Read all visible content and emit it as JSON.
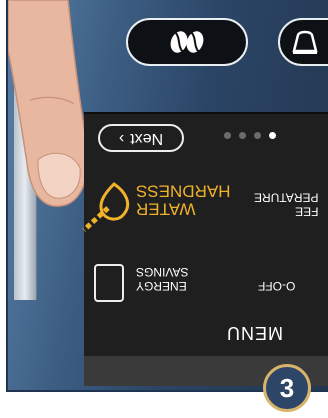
{
  "photo": {
    "coffee_button_icon": "coffee-beans-icon",
    "cup_button_icon": "cup-icon",
    "step_number": "3"
  },
  "screen": {
    "next_label": "Next",
    "page_dots_total": 4,
    "page_dots_active_index": 0,
    "menu_title": "MENU",
    "water_hardness_label": "WATER\nHARDNESS",
    "temperature_label": "FEE\nPERATURE",
    "energy_savings_label": "ENERGY\nSAVINGS",
    "auto_off_label": "O-OFF",
    "accent_color": "#f0b22a"
  }
}
